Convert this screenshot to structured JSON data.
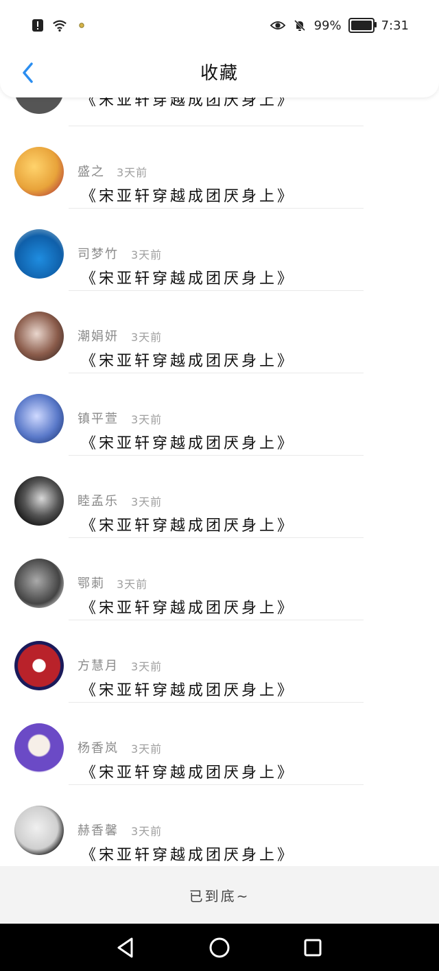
{
  "status_bar": {
    "battery_percent": "99%",
    "time": "7:31",
    "icons": [
      "warning-icon",
      "wifi-icon",
      "dot-icon",
      "eye-icon",
      "bell-off-icon",
      "battery-icon"
    ]
  },
  "header": {
    "title": "收藏"
  },
  "feed": {
    "items": [
      {
        "name": "盛之",
        "time": "3天前",
        "content": "《宋亚轩穿越成团厌身上》",
        "avatar_color": "#f2c35a"
      },
      {
        "name": "司梦竹",
        "time": "3天前",
        "content": "《宋亚轩穿越成团厌身上》",
        "avatar_color": "#2a8cd6"
      },
      {
        "name": "潮娟妍",
        "time": "3天前",
        "content": "《宋亚轩穿越成团厌身上》",
        "avatar_color": "#8a5b4a"
      },
      {
        "name": "镇平萱",
        "time": "3天前",
        "content": "《宋亚轩穿越成团厌身上》",
        "avatar_color": "#5a79c9"
      },
      {
        "name": "睦孟乐",
        "time": "3天前",
        "content": "《宋亚轩穿越成团厌身上》",
        "avatar_color": "#111111"
      },
      {
        "name": "鄂莿",
        "time": "3天前",
        "content": "《宋亚轩穿越成团厌身上》",
        "avatar_color": "#444444"
      },
      {
        "name": "方慧月",
        "time": "3天前",
        "content": "《宋亚轩穿越成团厌身上》",
        "avatar_color": "#b9222a"
      },
      {
        "name": "杨香岚",
        "time": "3天前",
        "content": "《宋亚轩穿越成团厌身上》",
        "avatar_color": "#6b4ac6"
      },
      {
        "name": "赫香馨",
        "time": "3天前",
        "content": "《宋亚轩穿越成团厌身上》",
        "avatar_color": "#cfcfcf"
      }
    ],
    "partial_item_content": "《宋亚轩穿越成团厌身上》"
  },
  "footer": {
    "end_text": "已到底~"
  }
}
